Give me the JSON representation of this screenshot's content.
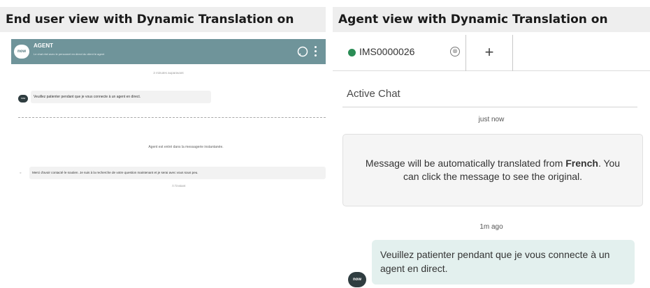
{
  "left_panel": {
    "title": "End user view with Dynamic Translation on",
    "header": {
      "logo": "now",
      "title": "AGENT",
      "subtitle": "Le chat réel avec le personnel en direct du client le agent"
    },
    "timestamp_top": "2 minutes auparavant",
    "avatar": "now",
    "message_1": "Veuillez patienter pendant que je vous connecte à un agent en direct.",
    "status": "Agent est entré dans la messagerie instantanée.",
    "message_2": "Merci d'avoir contacté le soutien. Je suis à la recherche de votre question maintenant et je serai avec vous sous peu.",
    "timestamp_bottom": "À l'instant"
  },
  "right_panel": {
    "title": "Agent view with Dynamic Translation on",
    "tab": {
      "label": "IMS0000026",
      "close": "⊗",
      "add": "+"
    },
    "active_chat": "Active Chat",
    "timestamp_1": "just now",
    "notice": {
      "pre": "Message will be automatically translated from ",
      "language": "French",
      "post": ". You can click the message to see the original."
    },
    "timestamp_2": "1m ago",
    "avatar": "now",
    "message": "Veuillez patienter pendant que je vous connecte à un agent en direct."
  },
  "colors": {
    "header_teal": "#6f949a",
    "status_green": "#2a8c55",
    "agent_bubble": "#e3f0ee"
  }
}
